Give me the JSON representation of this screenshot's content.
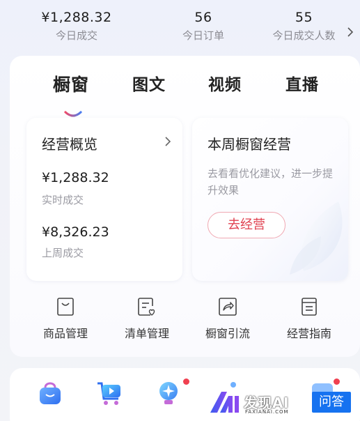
{
  "stats": [
    {
      "value": "¥1,288.32",
      "label": "今日成交"
    },
    {
      "value": "56",
      "label": "今日订单"
    },
    {
      "value": "55",
      "label": "今日成交人数"
    }
  ],
  "tabs": [
    {
      "label": "橱窗",
      "active": true
    },
    {
      "label": "图文",
      "active": false
    },
    {
      "label": "视频",
      "active": false
    },
    {
      "label": "直播",
      "active": false
    }
  ],
  "overview": {
    "title": "经营概览",
    "realtime_amount": "¥1,288.32",
    "realtime_label": "实时成交",
    "lastweek_amount": "¥8,326.23",
    "lastweek_label": "上周成交"
  },
  "weekly": {
    "title": "本周橱窗经营",
    "desc": "去看看优化建议，进一步提升效果",
    "button": "去经营"
  },
  "tools": [
    {
      "label": "商品管理",
      "icon": "bag-icon"
    },
    {
      "label": "清单管理",
      "icon": "checklist-icon"
    },
    {
      "label": "橱窗引流",
      "icon": "share-icon"
    },
    {
      "label": "经营指南",
      "icon": "guide-icon"
    }
  ],
  "watermark": {
    "brand": "发现AI",
    "domain": "FAXIANAI.COM",
    "badge": "问答"
  },
  "colors": {
    "accent_red": "#e0414f",
    "tab_underline_gradient": [
      "#4b7df0",
      "#ef4b6a"
    ],
    "brand_blue": "#1672f0"
  }
}
